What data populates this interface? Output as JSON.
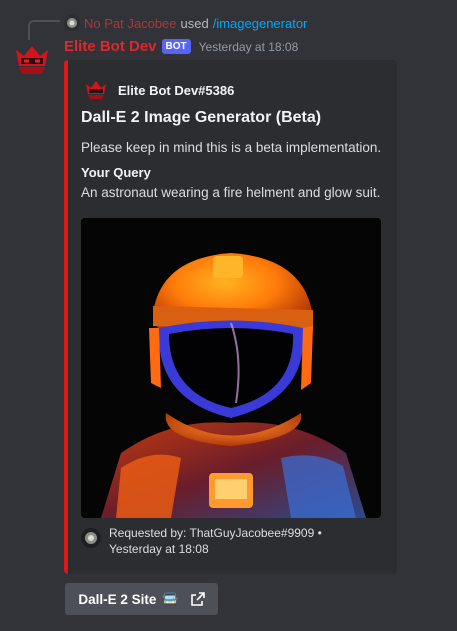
{
  "reply": {
    "user": "No Pat Jacobee",
    "action": "used",
    "command": "/imagegenerator"
  },
  "message": {
    "username": "Elite Bot Dev",
    "bot_tag": "BOT",
    "timestamp": "Yesterday at 18:08",
    "accent_color": "#e0171a"
  },
  "embed": {
    "author": "Elite Bot Dev#5386",
    "title": "Dall-E 2 Image Generator (Beta)",
    "description": "Please keep in mind this is a beta implementation.",
    "field_name": "Your Query",
    "field_value": "An astronaut wearing a fire helment and glow suit.",
    "footer": "Requested by: ThatGuyJacobee#9909 • Yesterday at 18:08"
  },
  "button": {
    "label": "Dall-E 2 Site",
    "emoji": "🚍",
    "icon": "external-link-icon"
  }
}
